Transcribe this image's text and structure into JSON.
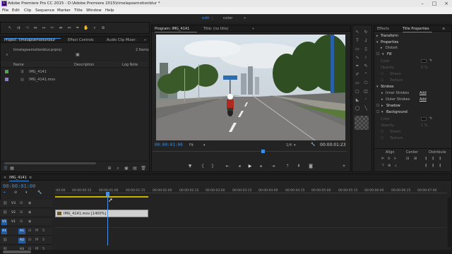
{
  "titlebar": {
    "title": "Adobe Premiere Pro CC 2015 - D:\\Adobe Premiere 2015\\timelapsemotionblur *",
    "app_icon_label": "Pr"
  },
  "menu": [
    "File",
    "Edit",
    "Clip",
    "Sequence",
    "Marker",
    "Title",
    "Window",
    "Help"
  ],
  "workspace": {
    "tabs": [
      "edit",
      "color"
    ],
    "more": "»"
  },
  "project": {
    "tabs": [
      "Project: timelapsemotionblur",
      "Effect Controls",
      "Audio Clip Mixer:"
    ],
    "more": "»",
    "file": "timelapsemotionblur.prproj",
    "item_count": "2 Items",
    "columns": [
      "Name",
      "Description",
      "Log Note"
    ],
    "items": [
      {
        "name": "IMG_4141",
        "color": "#4aa84a"
      },
      {
        "name": "IMG_4141.mov",
        "color": "#8c7ec4"
      }
    ]
  },
  "program": {
    "tabs": [
      "Program: IMG_4141",
      "Title: (no title)"
    ],
    "more": "»",
    "timecode": "00:00:01:00",
    "fit": "Fit",
    "fraction": "1/4",
    "duration": "00:00:01:23"
  },
  "effects": {
    "tabs": [
      "Effects",
      "Title Properties"
    ]
  },
  "props": {
    "transform": "Transform",
    "properties": "Properties",
    "distort": "Distort",
    "fill": "Fill",
    "color": "Color",
    "opacity": "Opacity",
    "sheen": "Sheen",
    "texture": "Texture",
    "strokes": "Strokes",
    "inner": "Inner Strokes",
    "outer": "Outer Strokes",
    "add": "Add",
    "shadow": "Shadow",
    "background": "Background",
    "align": "Align",
    "center": "Center",
    "distribute": "Distribute",
    "fill_value": "0 %",
    "bg_value": "1 %"
  },
  "timeline": {
    "tab": "IMG_4141",
    "timecode": "00:00:01:00",
    "ticks": [
      ":00:00",
      "00:00:00:15",
      "00:00:01:00",
      "00:00:01:15",
      "00:00:02:00",
      "00:00:02:15",
      "00:00:03:00",
      "00:00:03:15",
      "00:00:04:00",
      "00:00:04:15",
      "00:00:05:00",
      "00:00:05:15",
      "00:00:06:00",
      "00:00:06:15",
      "00:00:07:00"
    ],
    "video_tracks": [
      "V3",
      "V2",
      "V1"
    ],
    "audio_tracks": [
      "A1",
      "A2",
      "A3"
    ],
    "clip": "IMG_4141.mov [1400%]",
    "m": "M",
    "s": "S"
  },
  "colors": {
    "accent": "#3e8fe0",
    "clip": "#cfcfcf",
    "playhead": "#4a90e2",
    "tc": "#3e8fe0"
  }
}
